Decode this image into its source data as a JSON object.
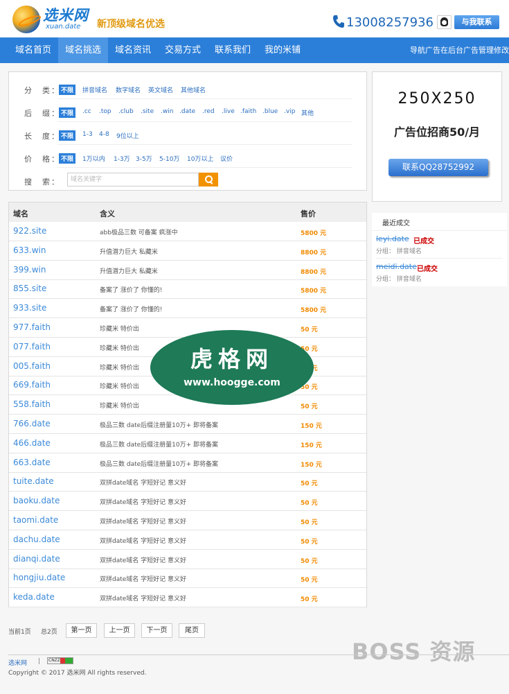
{
  "header": {
    "logo_main": "选米网",
    "logo_sub": "xuan.date",
    "slogan": "新顶级域名优选",
    "phone": "13008257936",
    "contact_label": "与我联系",
    "phone_icon": "phone-icon",
    "qq_icon": "qq-icon"
  },
  "nav": {
    "items": [
      "域名首页",
      "域名挑选",
      "域名资讯",
      "交易方式",
      "联系我们",
      "我的米铺"
    ],
    "active_index": 1,
    "note": "导航广告在后台广告管理修改"
  },
  "filter": {
    "category": {
      "label": "分　类：",
      "options": [
        "不限",
        "拼音域名",
        "数字域名",
        "英文域名",
        "其他域名"
      ]
    },
    "suffix": {
      "label": "后　缀：",
      "options": [
        "不限",
        ".cc",
        ".top",
        ".club",
        ".site",
        ".win",
        ".date",
        ".red",
        ".live",
        ".faith",
        ".blue",
        ".vip",
        "其他"
      ]
    },
    "length": {
      "label": "长　度：",
      "options": [
        "不限",
        "1-3",
        "4-8",
        "9位以上"
      ]
    },
    "price": {
      "label": "价　格：",
      "options": [
        "不限",
        "1万以内",
        "1-3万",
        "3-5万",
        "5-10万",
        "10万以上",
        "议价"
      ]
    },
    "search": {
      "label": "搜　索：",
      "placeholder": "域名关键字"
    }
  },
  "ad": {
    "size": "250X250",
    "text": "广告位招商50/月",
    "button": "联系QQ28752992"
  },
  "recent": {
    "title": "最近成交",
    "items": [
      {
        "name": "leyi.date",
        "status": "已成交",
        "category": "分组：  拼音域名"
      },
      {
        "name": "meidi.date",
        "status": "已成交",
        "category": "分组：  拼音域名"
      }
    ]
  },
  "table": {
    "headers": [
      "域名",
      "含义",
      "售价"
    ],
    "rows": [
      {
        "name": "922.site",
        "desc": "abb极品三数 可备案 疯涨中",
        "price": "5800 元"
      },
      {
        "name": "633.win",
        "desc": "升值潜力巨大 私藏米",
        "price": "8800 元"
      },
      {
        "name": "399.win",
        "desc": "升值潜力巨大 私藏米",
        "price": "8800 元"
      },
      {
        "name": "855.site",
        "desc": "备案了 涨价了 你懂的!",
        "price": "5800 元"
      },
      {
        "name": "933.site",
        "desc": "备案了 涨价了 你懂的!",
        "price": "5800 元"
      },
      {
        "name": "977.faith",
        "desc": "珍藏米 特价出",
        "price": "50 元"
      },
      {
        "name": "077.faith",
        "desc": "珍藏米 特价出",
        "price": "50 元"
      },
      {
        "name": "005.faith",
        "desc": "珍藏米 特价出",
        "price": "50 元"
      },
      {
        "name": "669.faith",
        "desc": "珍藏米 特价出",
        "price": "50 元"
      },
      {
        "name": "558.faith",
        "desc": "珍藏米 特价出",
        "price": "50 元"
      },
      {
        "name": "766.date",
        "desc": "极品三数 date后缀注册量10万+ 即将备案",
        "price": "150 元"
      },
      {
        "name": "466.date",
        "desc": "极品三数 date后缀注册量10万+ 即将备案",
        "price": "150 元"
      },
      {
        "name": "663.date",
        "desc": "极品三数 date后缀注册量10万+ 即将备案",
        "price": "150 元"
      },
      {
        "name": "tuite.date",
        "desc": "双拼date域名 字短好记 意义好",
        "price": "50 元"
      },
      {
        "name": "baoku.date",
        "desc": "双拼date域名 字短好记 意义好",
        "price": "50 元"
      },
      {
        "name": "taomi.date",
        "desc": "双拼date域名 字短好记 意义好",
        "price": "50 元"
      },
      {
        "name": "dachu.date",
        "desc": "双拼date域名 字短好记 意义好",
        "price": "50 元"
      },
      {
        "name": "dianqi.date",
        "desc": "双拼date域名 字短好记 意义好",
        "price": "50 元"
      },
      {
        "name": "hongjiu.date",
        "desc": "双拼date域名 字短好记 意义好",
        "price": "50 元"
      },
      {
        "name": "keda.date",
        "desc": "双拼date域名 字短好记 意义好",
        "price": "50 元"
      }
    ]
  },
  "pager": {
    "current": "当前1页",
    "total": "总2页",
    "buttons": [
      "第一页",
      "上一页",
      "下一页",
      "尾页"
    ]
  },
  "footer": {
    "link": "选米网",
    "pipe": "|",
    "cnzz": "CNZZ",
    "copyright": "Copyright © 2017 选米网 All rights reserved."
  },
  "watermark": {
    "title": "虎格网",
    "url": "www.hoogge.com",
    "boss": "BOSS 资源"
  },
  "colors": {
    "nav_bg": "#2c7fd9",
    "link": "#3c8ad8",
    "price": "#f08a00",
    "search_btn": "#f29200",
    "status": "#cc0000"
  }
}
